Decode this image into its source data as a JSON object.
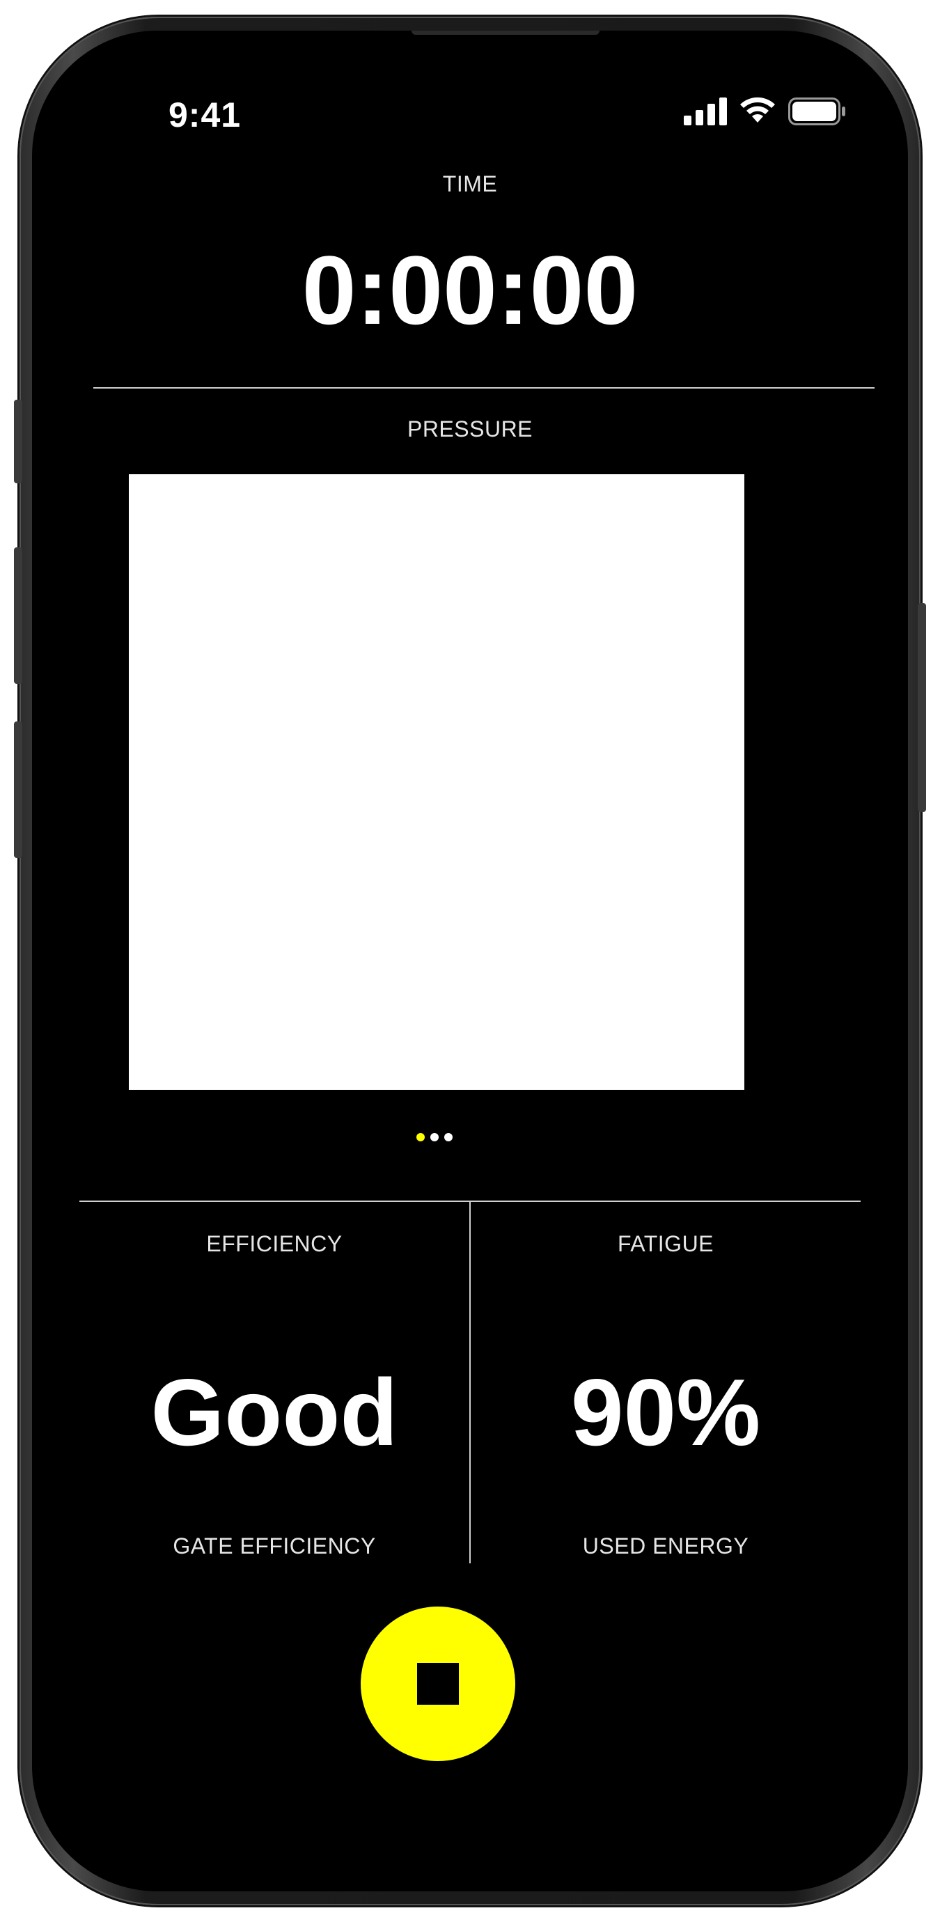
{
  "status_bar": {
    "time": "9:41"
  },
  "timer": {
    "label": "TIME",
    "value": "0:00:00"
  },
  "pressure": {
    "label": "PRESSURE"
  },
  "pager": {
    "active_index": 0,
    "count": 3,
    "active_color": "#ffff00",
    "inactive_color": "#ffffff"
  },
  "efficiency": {
    "label": "EFFICIENCY",
    "value": "Good",
    "caption": "GATE EFFICIENCY"
  },
  "fatigue": {
    "label": "FATIGUE",
    "value": "90%",
    "caption": "USED ENERGY"
  },
  "controls": {
    "stop_icon": "stop-icon",
    "accent": "#ffff00"
  },
  "colors": {
    "background": "#000000",
    "text": "#ffffff",
    "accent": "#ffff00"
  }
}
